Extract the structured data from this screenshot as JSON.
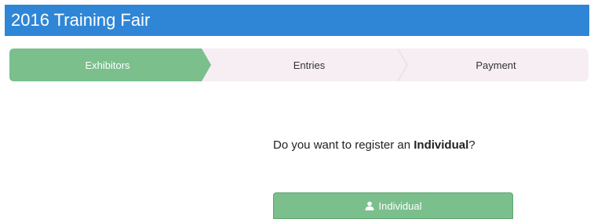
{
  "header": {
    "title": "2016 Training Fair"
  },
  "wizard": {
    "steps": [
      {
        "label": "Exhibitors",
        "active": true
      },
      {
        "label": "Entries",
        "active": false
      },
      {
        "label": "Payment",
        "active": false
      }
    ]
  },
  "prompt": {
    "before": "Do you want to register an ",
    "emphasis": "Individual",
    "after": "?"
  },
  "individual_button": {
    "label": "Individual",
    "icon": "user-icon"
  },
  "colors": {
    "header": "#2f86d6",
    "active_step": "#7bbf8d",
    "inactive_step": "#f6eef3",
    "button": "#7bbf8d"
  }
}
